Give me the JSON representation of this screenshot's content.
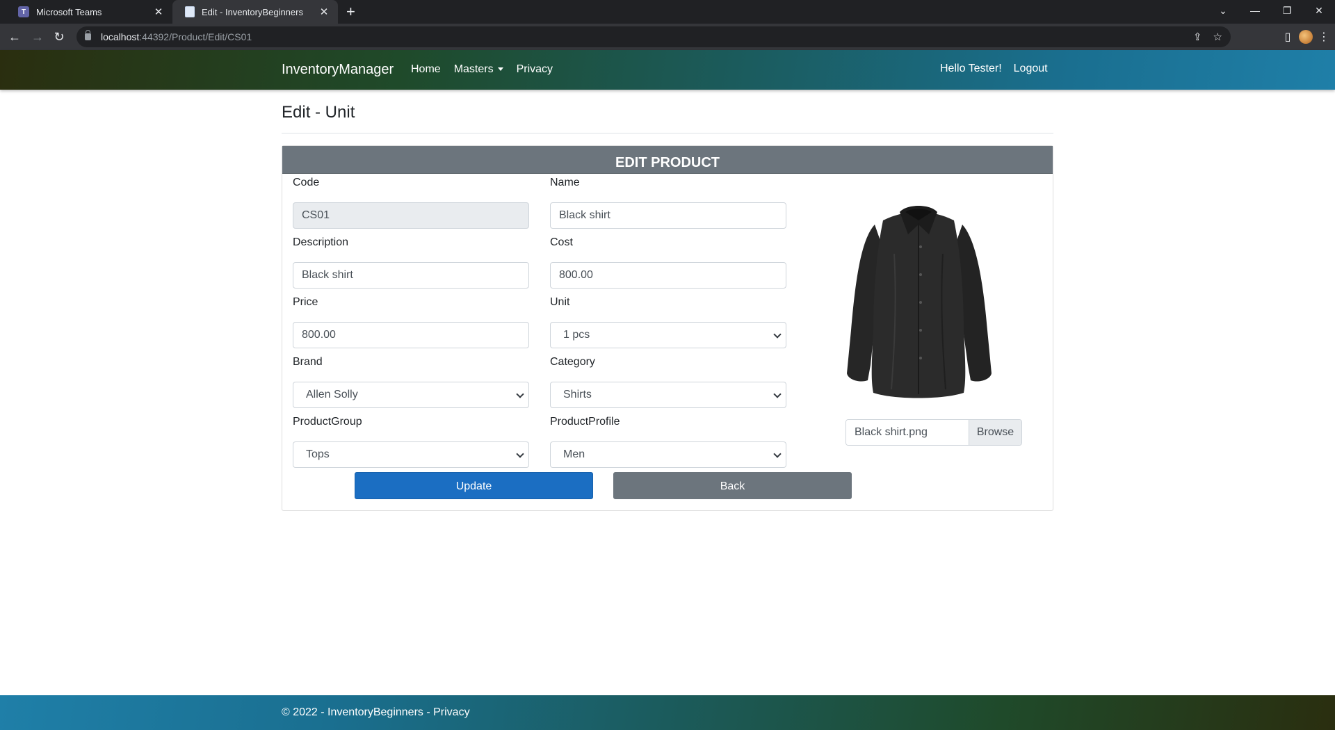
{
  "browser": {
    "tabs": [
      {
        "title": "Microsoft Teams",
        "close": "✕"
      },
      {
        "title": "Edit - InventoryBeginners",
        "close": "✕"
      }
    ],
    "new_tab": "+",
    "url_host": "localhost",
    "url_path": ":44392/Product/Edit/CS01",
    "window_controls": {
      "minimize": "—",
      "restore": "❐",
      "close": "✕",
      "tab_search": "⌄"
    }
  },
  "navbar": {
    "brand": "InventoryManager",
    "links": [
      "Home",
      "Masters",
      "Privacy"
    ],
    "greeting": "Hello Tester!",
    "logout": "Logout"
  },
  "page": {
    "heading": "Edit - Unit"
  },
  "card": {
    "header": "EDIT PRODUCT",
    "fields": {
      "code": {
        "label": "Code",
        "value": "CS01"
      },
      "name": {
        "label": "Name",
        "value": "Black shirt"
      },
      "description": {
        "label": "Description",
        "value": "Black shirt"
      },
      "cost": {
        "label": "Cost",
        "value": "800.00"
      },
      "price": {
        "label": "Price",
        "value": "800.00"
      },
      "unit": {
        "label": "Unit",
        "value": "1 pcs"
      },
      "brand": {
        "label": "Brand",
        "value": "Allen Solly"
      },
      "category": {
        "label": "Category",
        "value": "Shirts"
      },
      "product_group": {
        "label": "ProductGroup",
        "value": "Tops"
      },
      "product_profile": {
        "label": "ProductProfile",
        "value": "Men"
      }
    },
    "image_file": {
      "name": "Black shirt.png",
      "browse_label": "Browse"
    },
    "buttons": {
      "update": "Update",
      "back": "Back"
    }
  },
  "footer": {
    "text": "© 2022 - InventoryBeginners - ",
    "privacy_link": "Privacy"
  },
  "colors": {
    "primary": "#1b6ec2",
    "secondary": "#6c757d",
    "nav_gradient_start": "#2a2e0f",
    "nav_gradient_end": "#1f7fa8"
  }
}
